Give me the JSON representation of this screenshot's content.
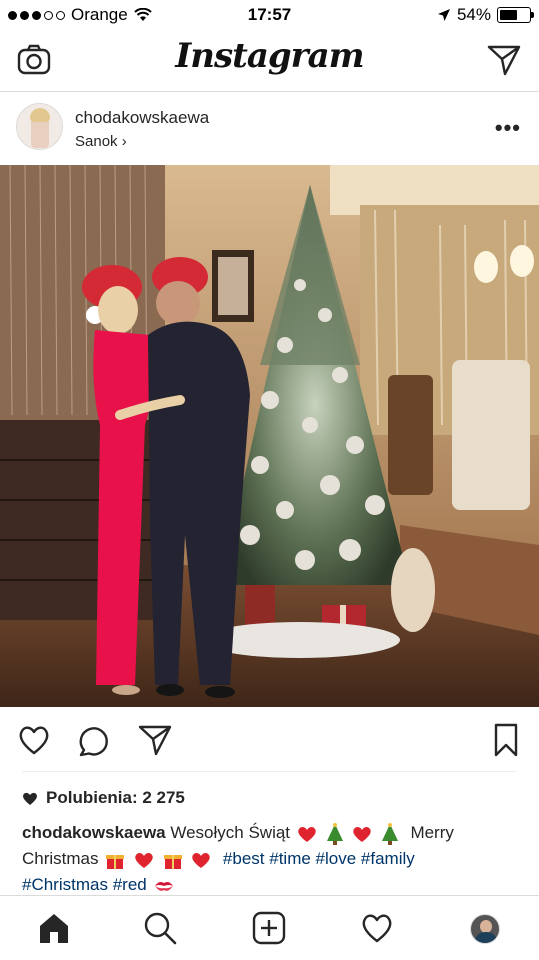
{
  "status_bar": {
    "carrier": "Orange",
    "time": "17:57",
    "battery": "54%",
    "battery_level": 0.54
  },
  "header": {
    "title": "Instagram",
    "left_icon": "camera-icon",
    "right_icon": "direct-send-icon"
  },
  "post": {
    "username": "chodakowskaewa",
    "location": "Sanok",
    "location_chevron": "›",
    "more": "•••"
  },
  "actions": {
    "like_icon": "heart-icon",
    "comment_icon": "comment-icon",
    "share_icon": "send-icon",
    "save_icon": "bookmark-icon"
  },
  "likes": {
    "text": "Polubienia: 2 275"
  },
  "caption": {
    "username": "chodakowskaewa",
    "text1": "Wesołych Świąt",
    "text2": "Merry",
    "text3": "Christmas",
    "tags_line1": [
      "#best",
      "#time",
      "#love",
      "#family"
    ],
    "tags_line2": [
      "#Christmas",
      "#red"
    ]
  },
  "nav": {
    "items": [
      "home-icon",
      "search-icon",
      "add-post-icon",
      "activity-heart-icon",
      "profile-avatar"
    ]
  },
  "colors": {
    "hashtag": "#003569",
    "divider": "#dbdbdb",
    "text": "#262626"
  }
}
